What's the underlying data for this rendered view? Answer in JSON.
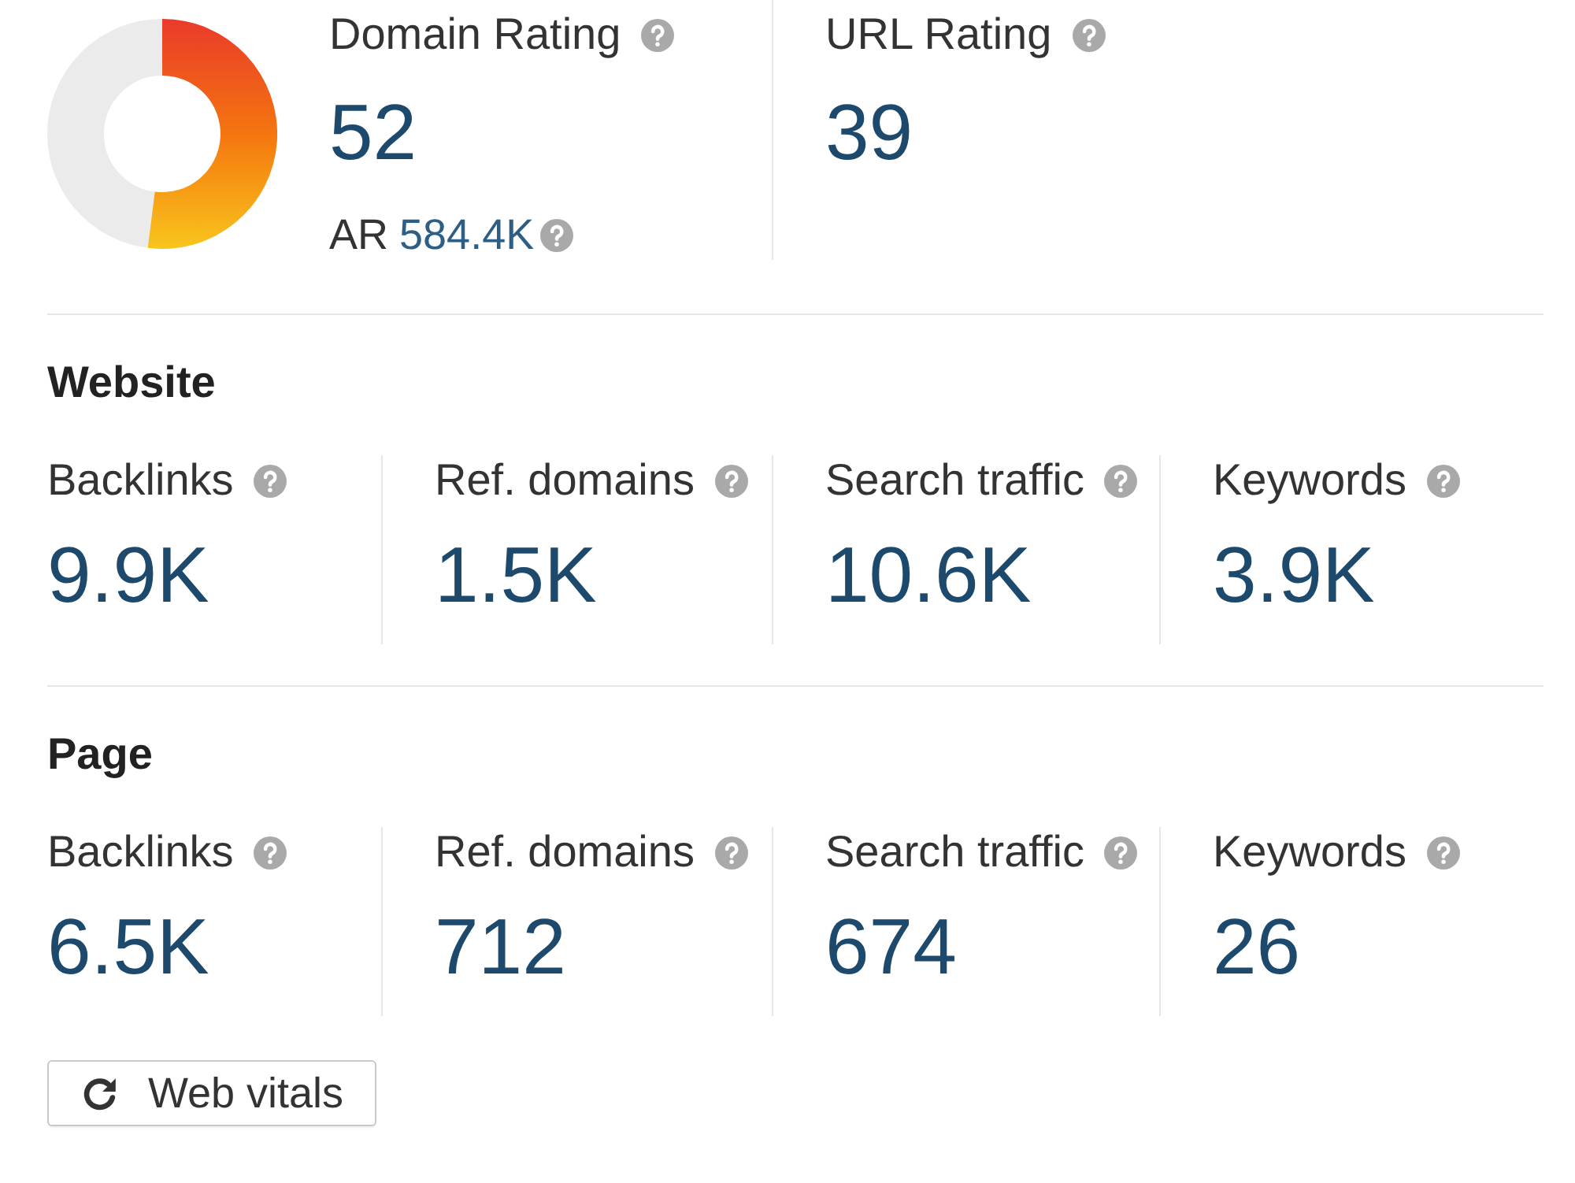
{
  "domain_rating": {
    "label": "Domain Rating",
    "value": "52",
    "level": 0.52,
    "ar": {
      "label": "AR",
      "value": "584.4K"
    }
  },
  "url_rating": {
    "label": "URL Rating",
    "value": "39"
  },
  "sections": [
    {
      "title": "Website",
      "metrics": [
        {
          "label": "Backlinks",
          "value": "9.9K"
        },
        {
          "label": "Ref. domains",
          "value": "1.5K"
        },
        {
          "label": "Search traffic",
          "value": "10.6K"
        },
        {
          "label": "Keywords",
          "value": "3.9K"
        }
      ]
    },
    {
      "title": "Page",
      "metrics": [
        {
          "label": "Backlinks",
          "value": "6.5K"
        },
        {
          "label": "Ref. domains",
          "value": "712"
        },
        {
          "label": "Search traffic",
          "value": "674"
        },
        {
          "label": "Keywords",
          "value": "26"
        }
      ]
    }
  ],
  "button": {
    "label": "Web vitals"
  }
}
